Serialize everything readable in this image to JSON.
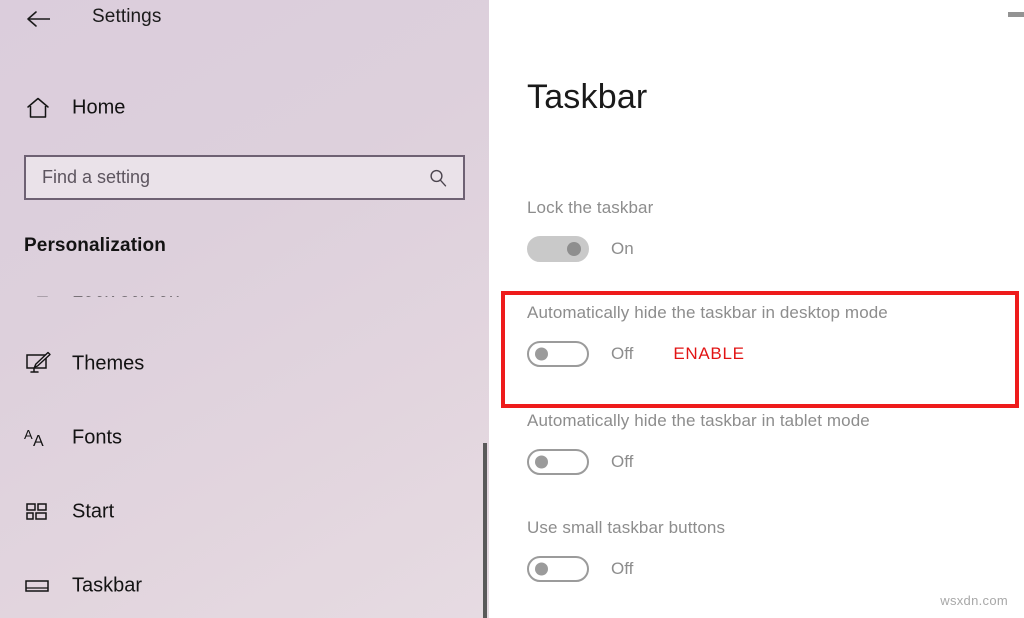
{
  "window": {
    "title": "Settings",
    "back_label": "Back",
    "back_icon": "arrow-left-icon"
  },
  "sidebar": {
    "home": {
      "label": "Home",
      "icon": "home-icon"
    },
    "search": {
      "placeholder": "Find a setting",
      "value": "",
      "icon": "search-icon"
    },
    "section_header": "Personalization",
    "items": [
      {
        "label": "Lock screen",
        "icon": "lock-screen-icon",
        "clipped": true
      },
      {
        "label": "Themes",
        "icon": "themes-brush-icon",
        "clipped": false
      },
      {
        "label": "Fonts",
        "icon": "fonts-aa-icon",
        "clipped": false
      },
      {
        "label": "Start",
        "icon": "start-tiles-icon",
        "clipped": false
      },
      {
        "label": "Taskbar",
        "icon": "taskbar-icon",
        "clipped": false
      }
    ],
    "background_color": "#ddd0dc",
    "scrollbar_color": "#5a5a5a"
  },
  "content": {
    "page_title": "Taskbar",
    "settings": [
      {
        "label": "Lock the taskbar",
        "state": "On",
        "toggle_on": true,
        "annotation": ""
      },
      {
        "label": "Automatically hide the taskbar in desktop mode",
        "state": "Off",
        "toggle_on": false,
        "annotation": "ENABLE"
      },
      {
        "label": "Automatically hide the taskbar in tablet mode",
        "state": "Off",
        "toggle_on": false,
        "annotation": ""
      },
      {
        "label": "Use small taskbar buttons",
        "state": "Off",
        "toggle_on": false,
        "annotation": ""
      }
    ]
  },
  "annotation": {
    "highlight_color": "#ee1b1b",
    "enable_text_color": "#e21414"
  },
  "watermark": {
    "text": "wsxdn.com"
  }
}
